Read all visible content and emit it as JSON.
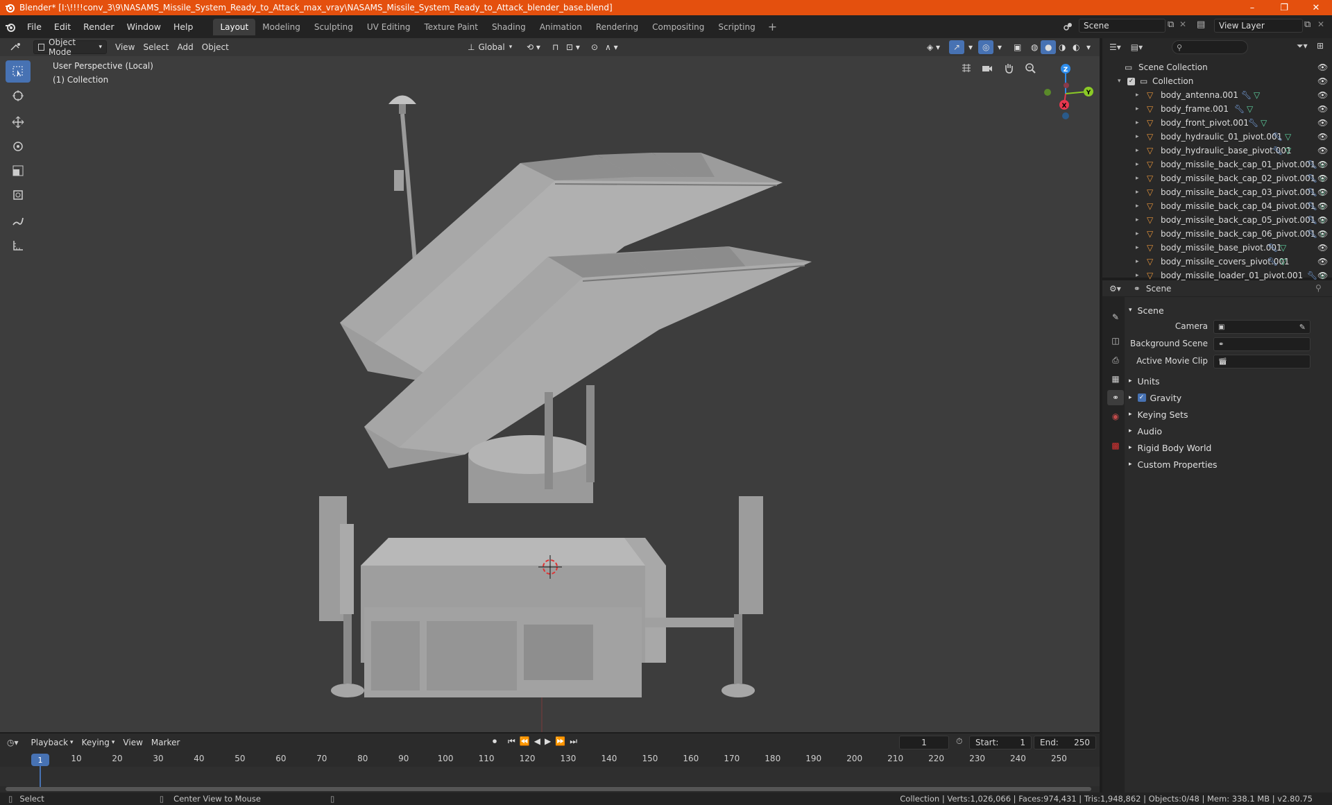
{
  "window": {
    "title": "Blender* [I:\\!!!!conv_3\\9\\NASAMS_Missile_System_Ready_to_Attack_max_vray\\NASAMS_Missile_System_Ready_to_Attack_blender_base.blend]",
    "minimize": "–",
    "maximize": "❐",
    "close": "✕"
  },
  "menu": [
    "File",
    "Edit",
    "Render",
    "Window",
    "Help"
  ],
  "workspaces": [
    "Layout",
    "Modeling",
    "Sculpting",
    "UV Editing",
    "Texture Paint",
    "Shading",
    "Animation",
    "Rendering",
    "Compositing",
    "Scripting"
  ],
  "active_workspace": "Layout",
  "scene_name": "Scene",
  "view_layer": "View Layer",
  "viewport": {
    "mode": "Object Mode",
    "menus": [
      "View",
      "Select",
      "Add",
      "Object"
    ],
    "transform_orientation": "Global",
    "info_line1": "User Perspective (Local)",
    "info_line2": "(1) Collection",
    "gizmo": {
      "z": "Z",
      "y": "Y",
      "x": "X"
    }
  },
  "outliner": {
    "root": "Scene Collection",
    "collection": "Collection",
    "items": [
      "body_antenna.001",
      "body_frame.001",
      "body_front_pivot.001",
      "body_hydraulic_01_pivot.001",
      "body_hydraulic_base_pivot.001",
      "body_missile_back_cap_01_pivot.001",
      "body_missile_back_cap_02_pivot.001",
      "body_missile_back_cap_03_pivot.001",
      "body_missile_back_cap_04_pivot.001",
      "body_missile_back_cap_05_pivot.001",
      "body_missile_back_cap_06_pivot.001",
      "body_missile_base_pivot.001",
      "body_missile_covers_pivot.001",
      "body_missile_loader_01_pivot.001"
    ]
  },
  "properties": {
    "context": "Scene",
    "section": "Scene",
    "camera_label": "Camera",
    "background_label": "Background Scene",
    "movie_clip_label": "Active Movie Clip",
    "panels": [
      "Units",
      "Gravity",
      "Keying Sets",
      "Audio",
      "Rigid Body World",
      "Custom Properties"
    ],
    "gravity_checked": true
  },
  "timeline": {
    "menus": [
      "Playback",
      "Keying",
      "View",
      "Marker"
    ],
    "current_frame": "1",
    "start_label": "Start:",
    "start": "1",
    "end_label": "End:",
    "end": "250",
    "ticks": [
      "1",
      "10",
      "20",
      "30",
      "40",
      "50",
      "60",
      "70",
      "80",
      "90",
      "100",
      "110",
      "120",
      "130",
      "140",
      "150",
      "160",
      "170",
      "180",
      "190",
      "200",
      "210",
      "220",
      "230",
      "240",
      "250"
    ]
  },
  "status": {
    "select": "Select",
    "center": "Center View to Mouse",
    "stats": "Collection | Verts:1,026,066 | Faces:974,431 | Tris:1,948,862 | Objects:0/48 | Mem: 338.1 MB | v2.80.75"
  },
  "colors": {
    "title_bar": "#e4500e",
    "accent": "#4772b3",
    "axis_x": "#e8374f",
    "axis_y": "#8bca26",
    "axis_z": "#2d8ceb"
  }
}
